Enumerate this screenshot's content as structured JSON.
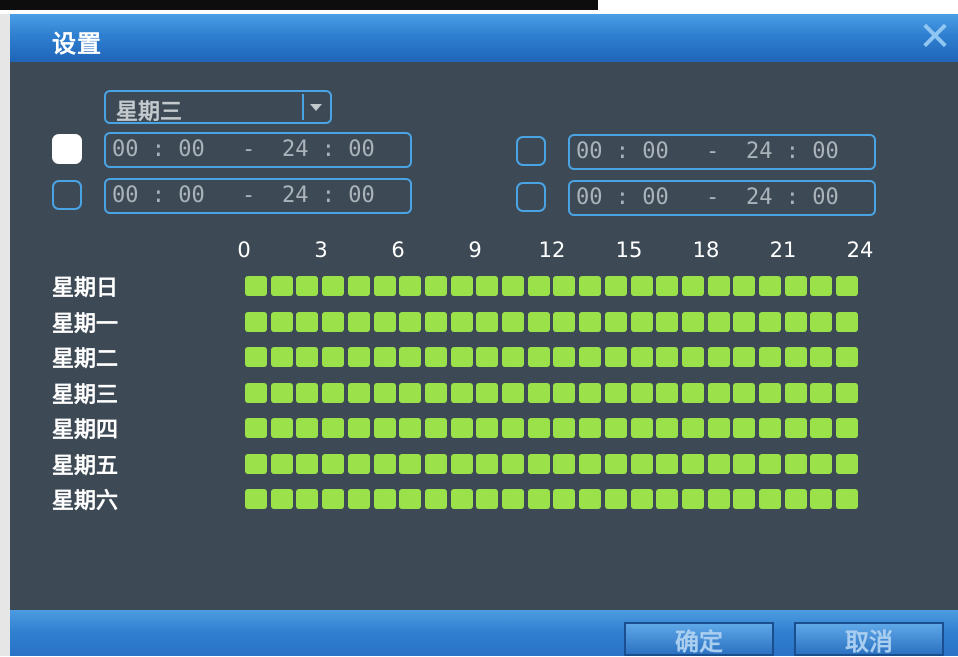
{
  "dialog": {
    "title": "设置",
    "close_icon": "close-icon"
  },
  "day_select": {
    "value": "星期三"
  },
  "time_ranges": [
    {
      "checked": true,
      "start": "00 : 00",
      "separator": "-",
      "end": "24 : 00"
    },
    {
      "checked": false,
      "start": "00 : 00",
      "separator": "-",
      "end": "24 : 00"
    },
    {
      "checked": false,
      "start": "00 : 00",
      "separator": "-",
      "end": "24 : 00"
    },
    {
      "checked": false,
      "start": "00 : 00",
      "separator": "-",
      "end": "24 : 00"
    }
  ],
  "schedule": {
    "hour_labels": [
      "0",
      "3",
      "6",
      "9",
      "12",
      "15",
      "18",
      "21",
      "24"
    ],
    "days": [
      "星期日",
      "星期一",
      "星期二",
      "星期三",
      "星期四",
      "星期五",
      "星期六"
    ],
    "cells_per_day": 24,
    "active_color": "#9be24a"
  },
  "footer": {
    "ok_label": "确定",
    "cancel_label": "取消"
  }
}
